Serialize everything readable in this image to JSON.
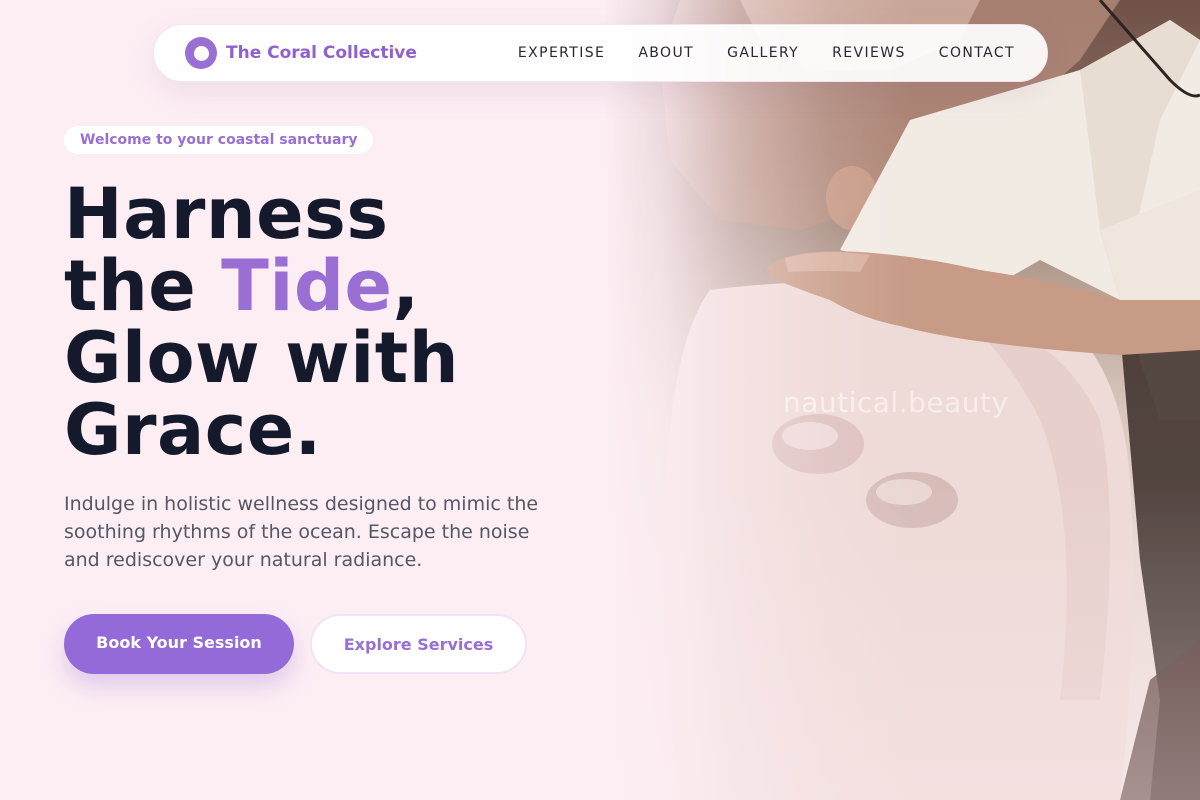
{
  "brand": {
    "name": "The Coral Collective",
    "icon": "ring-logo-icon"
  },
  "nav": {
    "links": [
      "EXPERTISE",
      "ABOUT",
      "GALLERY",
      "REVIEWS",
      "CONTACT"
    ]
  },
  "hero": {
    "tagline": "Welcome to your coastal sanctuary",
    "headline": {
      "line1": "Harness",
      "line2_prefix": "the ",
      "line2_accent": "Tide",
      "line2_suffix": ",",
      "line3": "Glow with",
      "line4": "Grace."
    },
    "subtext": "Indulge in holistic wellness designed to mimic the soothing rhythms of the ocean. Escape the noise and rediscover your natural radiance.",
    "primary_cta": "Book Your Session",
    "secondary_cta": "Explore Services",
    "photo_watermark": "nautical.beauty"
  },
  "colors": {
    "accent": "#9a6fd4",
    "background": "#fdeef4",
    "heading": "#141a2c",
    "body_text": "#545766"
  }
}
